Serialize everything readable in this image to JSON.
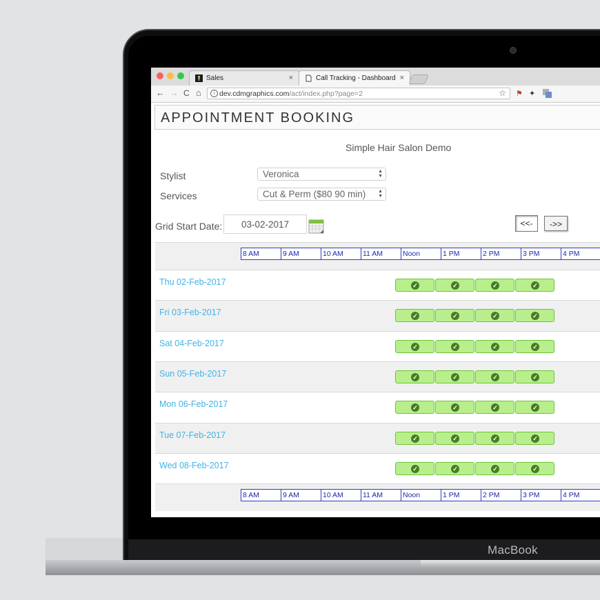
{
  "device": {
    "brand_label": "MacBook"
  },
  "browser": {
    "tabs": [
      {
        "label": "Sales",
        "icon": "ticket-favicon"
      },
      {
        "label": "Call Tracking - Dashboard",
        "icon": "document-favicon",
        "active": true
      }
    ],
    "close_glyph": "×",
    "url_host": "dev.cdmgraphics.com",
    "url_path": "/act/index.php?page=2",
    "nav": {
      "back": "←",
      "forward": "→",
      "reload": "C",
      "home": "⌂"
    }
  },
  "page": {
    "title": "APPOINTMENT BOOKING",
    "subtitle": "Simple Hair Salon Demo",
    "stylist": {
      "label": "Stylist",
      "value": "Veronica"
    },
    "services": {
      "label": "Services",
      "value": "Cut & Perm ($80 90 min)"
    },
    "grid_start": {
      "label": "Grid Start Date:",
      "value": "03-02-2017"
    },
    "prev_label": "<<-",
    "next_label": "->>",
    "hours": [
      "8 AM",
      "9 AM",
      "10 AM",
      "11 AM",
      "Noon",
      "1 PM",
      "2 PM",
      "3 PM",
      "4 PM"
    ],
    "days": [
      {
        "label": "Thu 02-Feb-2017",
        "available": [
          "Noon",
          "1 PM",
          "2 PM",
          "3 PM"
        ]
      },
      {
        "label": "Fri 03-Feb-2017",
        "available": [
          "Noon",
          "1 PM",
          "2 PM",
          "3 PM"
        ]
      },
      {
        "label": "Sat 04-Feb-2017",
        "available": [
          "Noon",
          "1 PM",
          "2 PM",
          "3 PM"
        ]
      },
      {
        "label": "Sun 05-Feb-2017",
        "available": [
          "Noon",
          "1 PM",
          "2 PM",
          "3 PM"
        ]
      },
      {
        "label": "Mon 06-Feb-2017",
        "available": [
          "Noon",
          "1 PM",
          "2 PM",
          "3 PM"
        ]
      },
      {
        "label": "Tue 07-Feb-2017",
        "available": [
          "Noon",
          "1 PM",
          "2 PM",
          "3 PM"
        ]
      },
      {
        "label": "Wed 08-Feb-2017",
        "available": [
          "Noon",
          "1 PM",
          "2 PM",
          "3 PM"
        ]
      }
    ],
    "colors": {
      "slot_fill": "#b8ef8c",
      "slot_border": "#6bc436",
      "day_link": "#3fb3e6",
      "hour_line": "#2b3ec2"
    }
  }
}
